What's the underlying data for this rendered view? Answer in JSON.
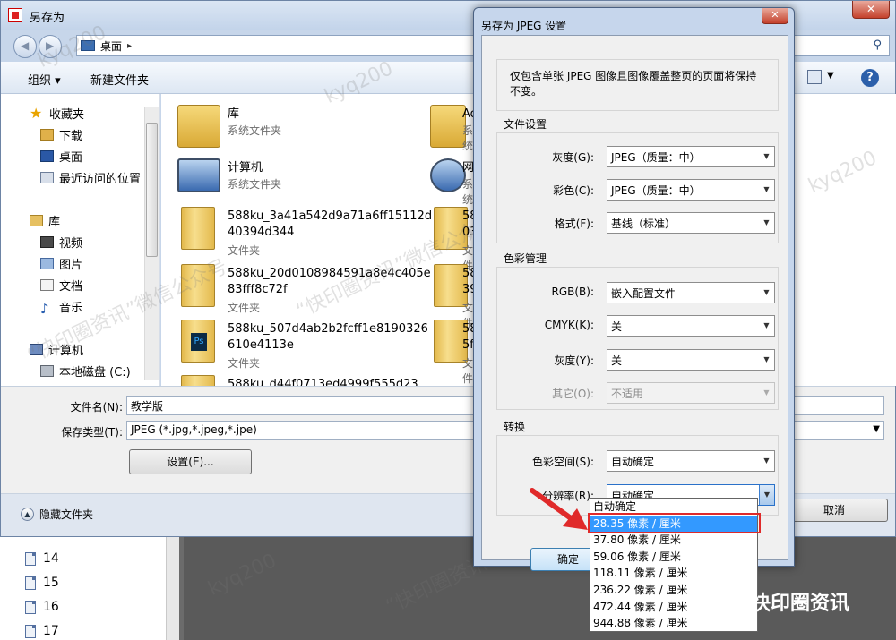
{
  "save_dialog": {
    "title": "另存为",
    "close_label": "✕",
    "address": {
      "location": "桌面",
      "sep": "▸"
    },
    "toolbar": {
      "organize": "组织 ▾",
      "new_folder": "新建文件夹",
      "view_arrow": "▼",
      "help": "?"
    },
    "nav": {
      "favorites": "收藏夹",
      "downloads": "下载",
      "desktop": "桌面",
      "recent": "最近访问的位置",
      "libraries": "库",
      "videos": "视频",
      "pictures": "图片",
      "documents": "文档",
      "music": "音乐",
      "computer": "计算机",
      "local_disk": "本地磁盘 (C:)"
    },
    "files": [
      {
        "name": "库",
        "type": "系统文件夹"
      },
      {
        "name": "计算机",
        "type": "系统文件夹"
      },
      {
        "name": "588ku_3a41a542d9a71a6ff15112d40394d344",
        "type": "文件夹"
      },
      {
        "name": "588ku_20d0108984591a8e4c405e83fff8c72f",
        "type": "文件夹"
      },
      {
        "name": "588ku_507d4ab2b2fcff1e8190326610e4113e",
        "type": "文件夹"
      },
      {
        "name": "588ku_d44f0713ed4999f555d23",
        "type": ""
      }
    ],
    "files_col2": [
      {
        "name": "Ad",
        "type": "系统"
      },
      {
        "name": "网",
        "type": "系统"
      },
      {
        "name": "58",
        "line2": "03",
        "type": "文件"
      },
      {
        "name": "58",
        "line2": "39",
        "type": "文件"
      },
      {
        "name": "58",
        "line2": "5f",
        "type": "文件"
      }
    ],
    "form": {
      "filename_label": "文件名(N):",
      "filename_value": "教学版",
      "filetype_label": "保存类型(T):",
      "filetype_value": "JPEG (*.jpg,*.jpeg,*.jpe)",
      "settings_button": "设置(E)..."
    },
    "footer": {
      "hide_folders": "隐藏文件夹",
      "cancel": "取消"
    }
  },
  "jpeg_dialog": {
    "title": "另存为 JPEG 设置",
    "close_label": "✕",
    "note": "仅包含单张 JPEG 图像且图像覆盖整页的页面将保持不变。",
    "file_settings": {
      "title": "文件设置",
      "gray_label": "灰度(G):",
      "gray_value": "JPEG（质量：中）",
      "color_label": "彩色(C):",
      "color_value": "JPEG（质量：中）",
      "format_label": "格式(F):",
      "format_value": "基线（标准）"
    },
    "color_mgmt": {
      "title": "色彩管理",
      "rgb_label": "RGB(B):",
      "rgb_value": "嵌入配置文件",
      "cmyk_label": "CMYK(K):",
      "cmyk_value": "关",
      "gray_label": "灰度(Y):",
      "gray_value": "关",
      "other_label": "其它(O):",
      "other_value": "不适用"
    },
    "conversion": {
      "title": "转换",
      "colorspace_label": "色彩空间(S):",
      "colorspace_value": "自动确定",
      "resolution_label": "分辨率(R):",
      "resolution_value": "自动确定"
    },
    "ok": "确定",
    "resolution_options": [
      "自动确定",
      "28.35 像素 / 厘米",
      "37.80 像素 / 厘米",
      "59.06 像素 / 厘米",
      "118.11 像素 / 厘米",
      "236.22 像素 / 厘米",
      "472.44 像素 / 厘米",
      "944.88 像素 / 厘米"
    ],
    "selected_option": "28.35 像素 / 厘米"
  },
  "background": {
    "page_numbers": [
      "14",
      "15",
      "16",
      "17"
    ]
  },
  "watermark": {
    "text": "kyq200",
    "text2": "“快印圈资讯”微信公众号",
    "brand": "快印圈资讯"
  },
  "colors": {
    "highlight": "#3399ff",
    "annotation": "#e02a2a"
  }
}
